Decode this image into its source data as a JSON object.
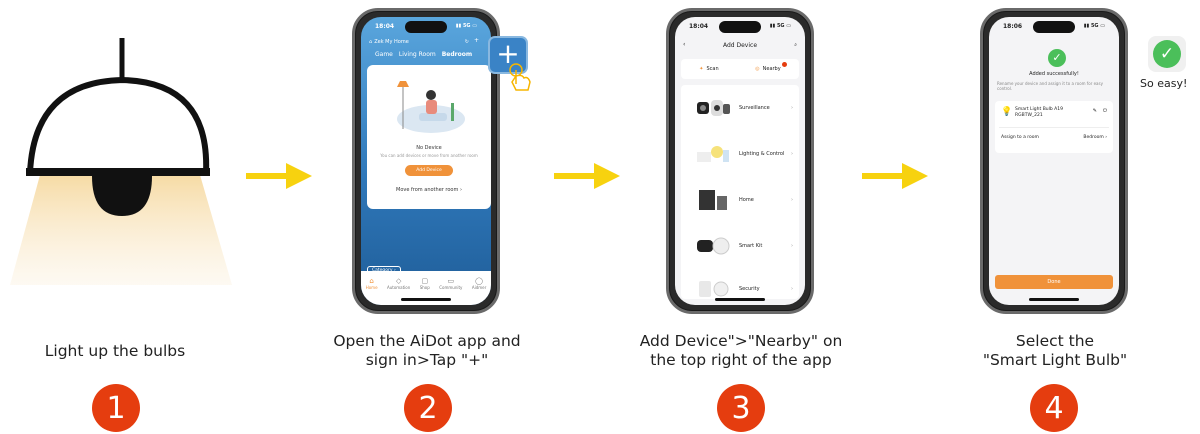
{
  "steps": [
    {
      "number": "1",
      "caption_line1": "Light up  the bulbs",
      "caption_line2": ""
    },
    {
      "number": "2",
      "caption_line1": "Open the AiDot app and",
      "caption_line2": "sign in>Tap \"+\""
    },
    {
      "number": "3",
      "caption_line1": "Add Device\">\"Nearby\" on",
      "caption_line2": "the top right of the app"
    },
    {
      "number": "4",
      "caption_line1": "Select the",
      "caption_line2": "\"Smart Light Bulb\""
    }
  ],
  "colors": {
    "badge": "#e53d0f",
    "arrow": "#f7d20f",
    "app_orange": "#f0923a",
    "app_blue": "#3a83c6",
    "success_green": "#4bbf5a"
  },
  "phone2": {
    "time": "18:04",
    "home_name": "Zek My Home",
    "tabs": [
      "Game",
      "Living Room",
      "Bedroom"
    ],
    "empty_title": "No Device",
    "empty_desc": "You can add devices or move from another room",
    "add_button": "Add Device",
    "move_link": "Move from another room",
    "category": "Category",
    "nav": [
      "Home",
      "Automation",
      "Shop",
      "Community",
      "Aidmer"
    ]
  },
  "phone3": {
    "time": "18:04",
    "title": "Add Device",
    "scan_label": "Scan",
    "nearby_label": "Nearby",
    "categories": [
      "Surveillance",
      "Lighting & Control",
      "Home",
      "Smart Kit",
      "Security"
    ]
  },
  "phone4": {
    "time": "18:06",
    "success_text": "Added successfully!",
    "rename_hint": "Rename your device and assign it to a room for easy control.",
    "device_name": "Smart Light Bulb A19",
    "device_model": "RGBTW_221",
    "assign_label": "Assign to a room",
    "room": "Bedroom",
    "done_button": "Done"
  },
  "so_easy": "So easy!",
  "icons": [
    "lamp-illustration",
    "arrow-right-icon",
    "plus-icon",
    "tap-hand-icon",
    "check-icon",
    "bulb-icon"
  ]
}
